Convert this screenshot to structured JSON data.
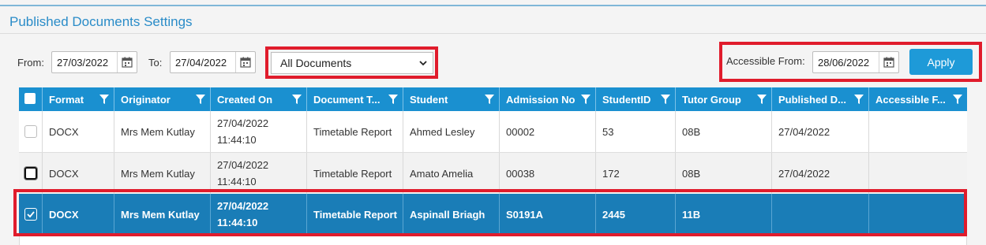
{
  "panel": {
    "title": "Published Documents Settings"
  },
  "filters": {
    "from_label": "From:",
    "from_value": "27/03/2022",
    "to_label": "To:",
    "to_value": "27/04/2022",
    "document_filter": "All Documents",
    "accessible_from_label": "Accessible From:",
    "accessible_from_value": "28/06/2022",
    "apply_label": "Apply"
  },
  "grid": {
    "columns": [
      "Format",
      "Originator",
      "Created On",
      "Document T...",
      "Student",
      "Admission No",
      "StudentID",
      "Tutor Group",
      "Published D...",
      "Accessible F..."
    ],
    "rows": [
      {
        "checked": false,
        "focused": false,
        "format": "DOCX",
        "originator": "Mrs Mem Kutlay",
        "created_date": "27/04/2022",
        "created_time": "11:44:10",
        "document_type": "Timetable Report",
        "student": "Ahmed Lesley",
        "admission_no": "00002",
        "student_id": "53",
        "tutor_group": "08B",
        "published_date": "27/04/2022",
        "accessible_from": ""
      },
      {
        "checked": false,
        "focused": true,
        "format": "DOCX",
        "originator": "Mrs Mem Kutlay",
        "created_date": "27/04/2022",
        "created_time": "11:44:10",
        "document_type": "Timetable Report",
        "student": "Amato Amelia",
        "admission_no": "00038",
        "student_id": "172",
        "tutor_group": "08B",
        "published_date": "27/04/2022",
        "accessible_from": ""
      },
      {
        "checked": true,
        "focused": false,
        "format": "DOCX",
        "originator": "Mrs Mem Kutlay",
        "created_date": "27/04/2022",
        "created_time": "11:44:10",
        "document_type": "Timetable Report",
        "student": "Aspinall Briagh",
        "admission_no": "S0191A",
        "student_id": "2445",
        "tutor_group": "11B",
        "published_date": "",
        "accessible_from": ""
      }
    ]
  },
  "colors": {
    "accent": "#1a90d0",
    "selected_row": "#1a7db7",
    "highlight": "#e01c2c",
    "title": "#2a8cc8"
  }
}
